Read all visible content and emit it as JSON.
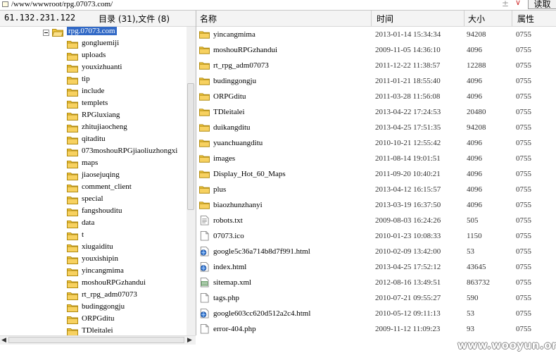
{
  "address_bar": {
    "path": "/www/wwwroot/rpg.07073.com/",
    "plus_glyph": "±",
    "dropdown_glyph": "∨",
    "read_button_label": "读取"
  },
  "left_pane": {
    "host_ip": "61.132.231.122",
    "dir_summary": "目录 (31),文件 (8)",
    "root_folder": "rpg.07073.com",
    "folders": [
      "gongluemiji",
      "uploads",
      "youxizhuanti",
      "tip",
      "include",
      "templets",
      "RPGluxiang",
      "zhitujiaocheng",
      "qitaditu",
      "073moshouRPGjiaoliuzhongxi",
      "maps",
      "jiaosejuqing",
      "comment_client",
      "special",
      "fangshouditu",
      "data",
      "t",
      "xiugaiditu",
      "youxishipin",
      "yincangmima",
      "moshouRPGzhandui",
      "rt_rpg_adm07073",
      "budinggongju",
      "ORPGditu",
      "TDleitalei"
    ],
    "scroll_left_glyph": "◀",
    "scroll_right_glyph": "▶"
  },
  "file_list": {
    "columns": [
      "名称",
      "时间",
      "大小",
      "属性"
    ],
    "rows": [
      {
        "name": "yincangmima",
        "time": "2013-01-14 15:34:34",
        "size": "94208",
        "attr": "0755",
        "icon": "folder-icon"
      },
      {
        "name": "moshouRPGzhandui",
        "time": "2009-11-05 14:36:10",
        "size": "4096",
        "attr": "0755",
        "icon": "folder-icon"
      },
      {
        "name": "rt_rpg_adm07073",
        "time": "2011-12-22 11:38:57",
        "size": "12288",
        "attr": "0755",
        "icon": "folder-icon"
      },
      {
        "name": "budinggongju",
        "time": "2011-01-21 18:55:40",
        "size": "4096",
        "attr": "0755",
        "icon": "folder-icon"
      },
      {
        "name": "ORPGditu",
        "time": "2011-03-28 11:56:08",
        "size": "4096",
        "attr": "0755",
        "icon": "folder-icon"
      },
      {
        "name": "TDleitalei",
        "time": "2013-04-22 17:24:53",
        "size": "20480",
        "attr": "0755",
        "icon": "folder-icon"
      },
      {
        "name": "duikangditu",
        "time": "2013-04-25 17:51:35",
        "size": "94208",
        "attr": "0755",
        "icon": "folder-icon"
      },
      {
        "name": "yuanchuangditu",
        "time": "2010-10-21 12:55:42",
        "size": "4096",
        "attr": "0755",
        "icon": "folder-icon"
      },
      {
        "name": "images",
        "time": "2011-08-14 19:01:51",
        "size": "4096",
        "attr": "0755",
        "icon": "folder-icon"
      },
      {
        "name": "Display_Hot_60_Maps",
        "time": "2011-09-20 10:40:21",
        "size": "4096",
        "attr": "0755",
        "icon": "folder-icon"
      },
      {
        "name": "plus",
        "time": "2013-04-12 16:15:57",
        "size": "4096",
        "attr": "0755",
        "icon": "folder-icon"
      },
      {
        "name": "biaozhunzhanyi",
        "time": "2013-03-19 16:37:50",
        "size": "4096",
        "attr": "0755",
        "icon": "folder-icon"
      },
      {
        "name": "robots.txt",
        "time": "2009-08-03 16:24:26",
        "size": "505",
        "attr": "0755",
        "icon": "text-file-icon"
      },
      {
        "name": "07073.ico",
        "time": "2010-01-23 10:08:33",
        "size": "1150",
        "attr": "0755",
        "icon": "blank-file-icon"
      },
      {
        "name": "google5c36a714b8d7f991.html",
        "time": "2010-02-09 13:42:00",
        "size": "53",
        "attr": "0755",
        "icon": "html-file-icon"
      },
      {
        "name": "index.html",
        "time": "2013-04-25 17:52:12",
        "size": "43645",
        "attr": "0755",
        "icon": "html-file-icon"
      },
      {
        "name": "sitemap.xml",
        "time": "2012-08-16 13:49:51",
        "size": "863732",
        "attr": "0755",
        "icon": "xml-file-icon"
      },
      {
        "name": "tags.php",
        "time": "2010-07-21 09:55:27",
        "size": "590",
        "attr": "0755",
        "icon": "blank-file-icon"
      },
      {
        "name": "google603cc620d512a2c4.html",
        "time": "2010-05-12 09:11:13",
        "size": "53",
        "attr": "0755",
        "icon": "html-file-icon"
      },
      {
        "name": "error-404.php",
        "time": "2009-11-12 11:09:23",
        "size": "93",
        "attr": "0755",
        "icon": "blank-file-icon"
      }
    ]
  },
  "watermark": "www.wooyun.org",
  "colors": {
    "selection": "#3169c6",
    "folder": "#f3c83c",
    "header_bg": "#f4f4f4"
  }
}
